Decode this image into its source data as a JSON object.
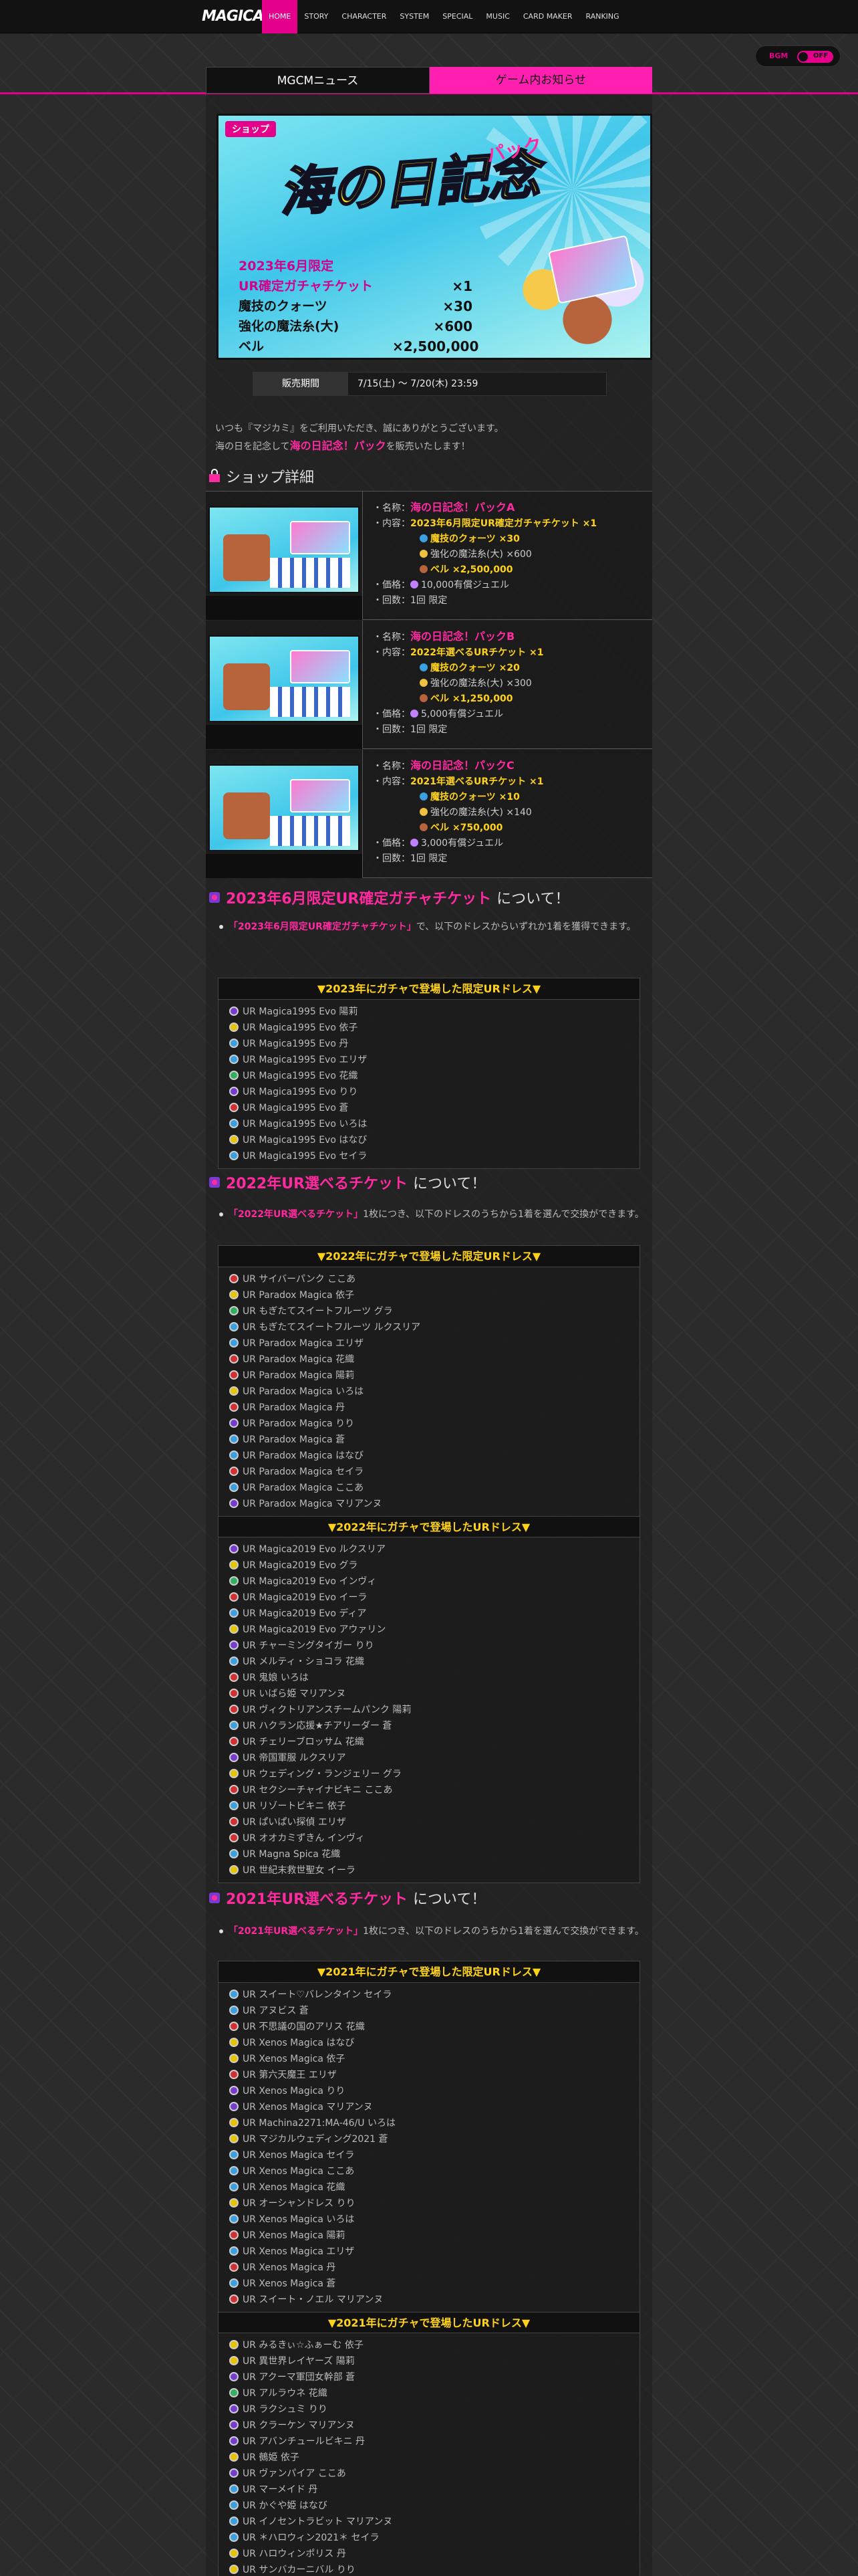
{
  "nav": {
    "logo": "MAGICAMI",
    "items": [
      "HOME",
      "STORY",
      "CHARACTER",
      "SYSTEM",
      "SPECIAL",
      "MUSIC",
      "CARD MAKER",
      "RANKING"
    ],
    "active": 0
  },
  "bgm": {
    "label": "BGM",
    "state": "OFF"
  },
  "tabs": [
    "MGCMニュース",
    "ゲーム内お知らせ"
  ],
  "banner": {
    "tag": "ショップ",
    "title": "海の日記念",
    "sub": "パック",
    "lines": [
      "2023年6月限定",
      "UR確定ガチャチケット",
      "魔技のクォーツ",
      "強化の魔法糸(大)",
      "ベル"
    ],
    "qty": [
      "×1",
      "×30",
      "×600",
      "×2,500,000"
    ]
  },
  "period": {
    "label": "販売期間",
    "value": "7/15(土) 〜 7/20(木) 23:59"
  },
  "intro": {
    "line1": "いつも『マジカミ』をご利用いただき、誠にありがとうございます。",
    "line2a": "海の日を記念して",
    "line2hl": "海の日記念！パック",
    "line2b": "を販売いたします！"
  },
  "shop_heading": "ショップ詳細",
  "packs": [
    {
      "name": "海の日記念！パックA",
      "item1": "2023年6月限定UR確定ガチャチケット ×1",
      "item2": "魔技のクォーツ ×30",
      "item3": "強化の魔法糸(大) ×600",
      "item4": "ベル ×2,500,000",
      "price": "10,000有償ジュエル",
      "count": "1回 限定"
    },
    {
      "name": "海の日記念！パックB",
      "item1": "2022年選べるURチケット ×1",
      "item2": "魔技のクォーツ ×20",
      "item3": "強化の魔法糸(大) ×300",
      "item4": "ベル ×1,250,000",
      "price": "5,000有償ジュエル",
      "count": "1回 限定"
    },
    {
      "name": "海の日記念！パックC",
      "item1": "2021年選べるURチケット ×1",
      "item2": "魔技のクォーツ ×10",
      "item3": "強化の魔法糸(大) ×140",
      "item4": "ベル ×750,000",
      "price": "3,000有償ジュエル",
      "count": "1回 限定"
    }
  ],
  "labels": {
    "name": "・名称：",
    "content": "・内容：",
    "price": "・価格：",
    "count": "・回数："
  },
  "sec1": {
    "title": "2023年6月限定UR確定ガチャチケット",
    "suffix": "について！",
    "bullet_hl": "「2023年6月限定UR確定ガチャチケット」",
    "bullet_text": "で、以下のドレスからいずれか1着を獲得できます。",
    "list_head": "▼2023年にガチャで登場した限定URドレス▼",
    "dresses": [
      "UR Magica1995 Evo 陽莉",
      "UR Magica1995 Evo 依子",
      "UR Magica1995 Evo 丹",
      "UR Magica1995 Evo エリザ",
      "UR Magica1995 Evo 花織",
      "UR Magica1995 Evo りり",
      "UR Magica1995 Evo 蒼",
      "UR Magica1995 Evo いろは",
      "UR Magica1995 Evo はなび",
      "UR Magica1995 Evo セイラ"
    ],
    "icons": [
      "purple",
      "star",
      "blue",
      "blue",
      "green",
      "purple",
      "red",
      "blue",
      "star",
      "blue"
    ]
  },
  "sec2": {
    "title": "2022年UR選べるチケット",
    "suffix": "について！",
    "bullet_hl": "「2022年UR選べるチケット」",
    "bullet_text": "1枚につき、以下のドレスのうちから1着を選んで交換ができます。",
    "list_head": "▼2022年にガチャで登場した限定URドレス▼",
    "dresses": [
      "UR サイバーパンク ここあ",
      "UR Paradox Magica 依子",
      "UR もぎたてスイートフルーツ グラ",
      "UR もぎたてスイートフルーツ ルクスリア",
      "UR Paradox Magica エリザ",
      "UR Paradox Magica 花織",
      "UR Paradox Magica 陽莉",
      "UR Paradox Magica いろは",
      "UR Paradox Magica 丹",
      "UR Paradox Magica りり",
      "UR Paradox Magica 蒼",
      "UR Paradox Magica はなび",
      "UR Paradox Magica セイラ",
      "UR Paradox Magica ここあ",
      "UR Paradox Magica マリアンヌ"
    ],
    "icons": [
      "red",
      "star",
      "green",
      "blue",
      "blue",
      "red",
      "red",
      "star",
      "red",
      "purple",
      "blue",
      "blue",
      "red",
      "blue",
      "purple"
    ],
    "list_head2": "▼2022年にガチャで登場したURドレス▼",
    "dresses2": [
      "UR Magica2019 Evo ルクスリア",
      "UR Magica2019 Evo グラ",
      "UR Magica2019 Evo インヴィ",
      "UR Magica2019 Evo イーラ",
      "UR Magica2019 Evo ディア",
      "UR Magica2019 Evo アウァリン",
      "UR チャーミングタイガー りり",
      "UR メルティ・ショコラ 花織",
      "UR 鬼娘 いろは",
      "UR いばら姫 マリアンヌ",
      "UR ヴィクトリアンスチームパンク 陽莉",
      "UR ハクラン応援★チアリーダー 蒼",
      "UR チェリーブロッサム 花織",
      "UR 帝国軍服 ルクスリア",
      "UR ウェディング・ランジェリー グラ",
      "UR セクシーチャイナビキニ ここあ",
      "UR リゾートビキニ 依子",
      "UR ぱいぱい探偵 エリザ",
      "UR オオカミずきん インヴィ",
      "UR Magna Spica 花織",
      "UR 世紀末救世聖女 イーラ"
    ],
    "icons2": [
      "purple",
      "star",
      "green",
      "red",
      "blue",
      "star",
      "purple",
      "blue",
      "red",
      "red",
      "red",
      "blue",
      "red",
      "purple",
      "star",
      "red",
      "blue",
      "red",
      "red",
      "blue",
      "star"
    ]
  },
  "sec3": {
    "title": "2021年UR選べるチケット",
    "suffix": "について！",
    "bullet_hl": "「2021年UR選べるチケット」",
    "bullet_text": "1枚につき、以下のドレスのうちから1着を選んで交換ができます。",
    "list_head": "▼2021年にガチャで登場した限定URドレス▼",
    "dresses": [
      "UR スイート♡バレンタイン セイラ",
      "UR アヌビス 蒼",
      "UR 不思議の国のアリス 花織",
      "UR Xenos Magica はなび",
      "UR Xenos Magica 依子",
      "UR 第六天魔王 エリザ",
      "UR Xenos Magica りり",
      "UR Xenos Magica マリアンヌ",
      "UR Machina2271:MA-46/U いろは",
      "UR マジカルウェディング2021 蒼",
      "UR Xenos Magica セイラ",
      "UR Xenos Magica ここあ",
      "UR Xenos Magica 花織",
      "UR オーシャンドレス りり",
      "UR Xenos Magica いろは",
      "UR Xenos Magica 陽莉",
      "UR Xenos Magica エリザ",
      "UR Xenos Magica 丹",
      "UR Xenos Magica 蒼",
      "UR スイート・ノエル マリアンヌ"
    ],
    "icons": [
      "blue",
      "blue",
      "red",
      "star",
      "star",
      "red",
      "purple",
      "purple",
      "star",
      "star",
      "blue",
      "blue",
      "blue",
      "star",
      "blue",
      "red",
      "blue",
      "red",
      "blue",
      "red"
    ],
    "list_head2": "▼2021年にガチャで登場したURドレス▼",
    "dresses2": [
      "UR みるきぃ☆ふぁーむ 依子",
      "UR 異世界レイヤーズ 陽莉",
      "UR アクーマ軍団女幹部 蒼",
      "UR アルラウネ 花織",
      "UR ラクシュミ りり",
      "UR クラーケン マリアンヌ",
      "UR アバンチュールビキニ 丹",
      "UR 鵺姫 依子",
      "UR ヴァンパイア ここあ",
      "UR マーメイド 丹",
      "UR かぐや姫 はなび",
      "UR イノセントラビット マリアンヌ",
      "UR ＊ハロウィン2021＊ セイラ",
      "UR ハロウィンポリス 丹",
      "UR サンバカーニバル りり"
    ],
    "icons2": [
      "star",
      "star",
      "purple",
      "green",
      "purple",
      "purple",
      "purple",
      "star",
      "purple",
      "blue",
      "blue",
      "blue",
      "blue",
      "star",
      "star"
    ]
  }
}
